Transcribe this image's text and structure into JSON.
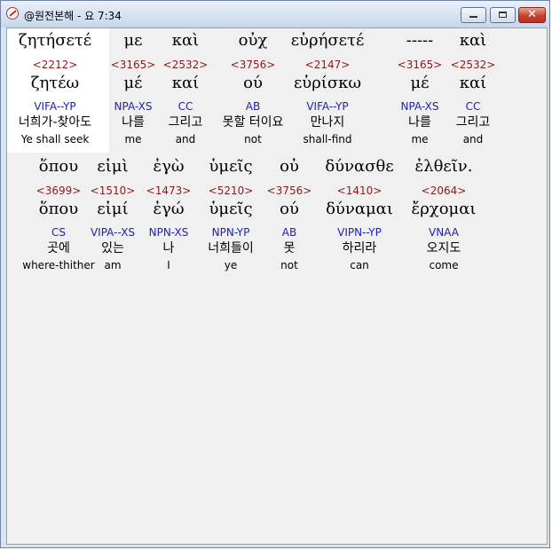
{
  "window": {
    "title": "@원전본해 - 요 7:34"
  },
  "lines": [
    {
      "words": [
        {
          "surface": "ζητήσετέ",
          "strong": "<2212>",
          "lemma": "ζητέω",
          "morph": "VIFA--YP",
          "korean": "너희가-찾아도",
          "english": "Ye shall seek"
        },
        {
          "surface": "με",
          "strong": "<3165>",
          "lemma": "μέ",
          "morph": "NPA-XS",
          "korean": "나를",
          "english": "me"
        },
        {
          "surface": "καὶ",
          "strong": "<2532>",
          "lemma": "καί",
          "morph": "CC",
          "korean": "그리고",
          "english": "and"
        },
        {
          "surface": "οὐχ",
          "strong": "<3756>",
          "lemma": "ού",
          "morph": "AB",
          "korean": "못할 터이요",
          "english": "not"
        },
        {
          "surface": "εὑρήσετέ",
          "strong": "<2147>",
          "lemma": "εὑρίσκω",
          "morph": "VIFA--YP",
          "korean": "만나지",
          "english": "shall-find"
        },
        {
          "surface": "-----",
          "strong": "<3165>",
          "lemma": "μέ",
          "morph": "NPA-XS",
          "korean": "나를",
          "english": "me"
        },
        {
          "surface": "καὶ",
          "strong": "<2532>",
          "lemma": "καί",
          "morph": "CC",
          "korean": "그리고",
          "english": "and"
        }
      ]
    },
    {
      "words": [
        {
          "surface": "ὅπου",
          "strong": "<3699>",
          "lemma": "ὅπου",
          "morph": "CS",
          "korean": "곳에",
          "english": "where-thither"
        },
        {
          "surface": "εἰμὶ",
          "strong": "<1510>",
          "lemma": "εἰμί",
          "morph": "VIPA--XS",
          "korean": "있는",
          "english": "am"
        },
        {
          "surface": "ἐγὼ",
          "strong": "<1473>",
          "lemma": "ἐγώ",
          "morph": "NPN-XS",
          "korean": "나",
          "english": "I"
        },
        {
          "surface": "ὑμεῖς",
          "strong": "<5210>",
          "lemma": "ὑμεῖς",
          "morph": "NPN-YP",
          "korean": "너희들이",
          "english": "ye"
        },
        {
          "surface": "οὐ",
          "strong": "<3756>",
          "lemma": "ού",
          "morph": "AB",
          "korean": "못",
          "english": "not"
        },
        {
          "surface": "δύνασθε",
          "strong": "<1410>",
          "lemma": "δύναμαι",
          "morph": "VIPN--YP",
          "korean": "하리라",
          "english": "can"
        },
        {
          "surface": "ἐλθεῖν.",
          "strong": "<2064>",
          "lemma": "ἔρχομαι",
          "morph": "VNAA",
          "korean": "오지도",
          "english": "come"
        }
      ]
    }
  ]
}
